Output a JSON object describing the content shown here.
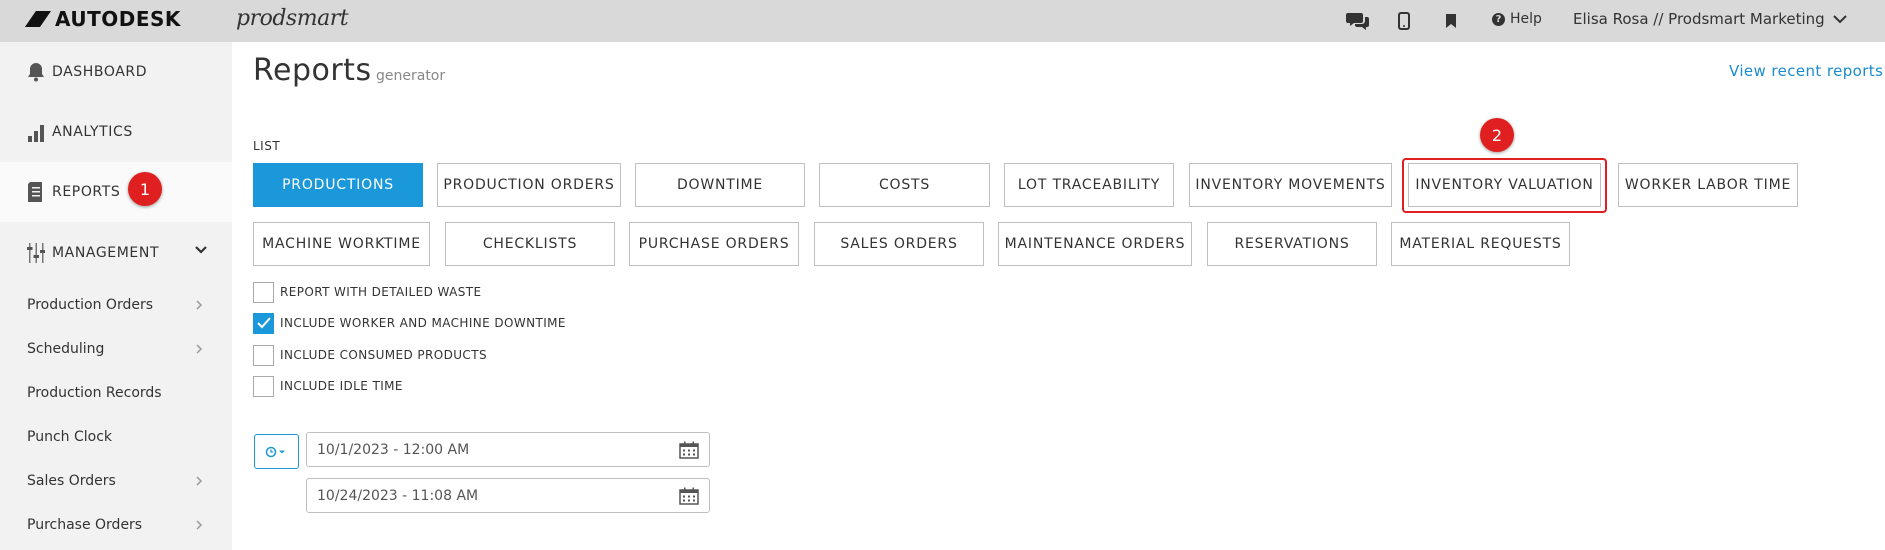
{
  "topbar": {
    "brand": "AUTODESK",
    "product": "prodsmart",
    "icons": [
      "chat-icon",
      "mobile-icon",
      "bookmark-icon"
    ],
    "help_label": "Help",
    "user_label": "Elisa Rosa // Prodsmart Marketing"
  },
  "sidebar": {
    "main_items": [
      {
        "label": "DASHBOARD",
        "icon": "bell-icon"
      },
      {
        "label": "ANALYTICS",
        "icon": "bar-chart-icon"
      },
      {
        "label": "REPORTS",
        "icon": "report-icon",
        "active": true
      },
      {
        "label": "MANAGEMENT",
        "icon": "sliders-icon",
        "expanded": true
      }
    ],
    "sub_items": [
      {
        "label": "Production Orders",
        "has_arrow": true
      },
      {
        "label": "Scheduling",
        "has_arrow": true
      },
      {
        "label": "Production Records",
        "has_arrow": false
      },
      {
        "label": "Punch Clock",
        "has_arrow": false
      },
      {
        "label": "Sales Orders",
        "has_arrow": true
      },
      {
        "label": "Purchase Orders",
        "has_arrow": true
      }
    ]
  },
  "annotations": {
    "badge1": "1",
    "badge2": "2",
    "color": "#e02020"
  },
  "main": {
    "title": "Reports",
    "subtitle": "generator",
    "recent_link": "View recent reports",
    "list_label": "LIST",
    "report_buttons_row1": [
      "PRODUCTIONS",
      "PRODUCTION ORDERS",
      "DOWNTIME",
      "COSTS",
      "LOT TRACEABILITY",
      "INVENTORY MOVEMENTS",
      "INVENTORY VALUATION",
      "WORKER LABOR TIME"
    ],
    "report_buttons_row2": [
      "MACHINE WORKTIME",
      "CHECKLISTS",
      "PURCHASE ORDERS",
      "SALES ORDERS",
      "MAINTENANCE ORDERS",
      "RESERVATIONS",
      "MATERIAL REQUESTS"
    ],
    "active_report": "PRODUCTIONS",
    "options": [
      {
        "label": "REPORT WITH DETAILED WASTE",
        "checked": false
      },
      {
        "label": "INCLUDE WORKER AND MACHINE DOWNTIME",
        "checked": true
      },
      {
        "label": "INCLUDE CONSUMED PRODUCTS",
        "checked": false
      },
      {
        "label": "INCLUDE IDLE TIME",
        "checked": false
      }
    ],
    "date_from": "10/1/2023 - 12:00 AM",
    "date_to": "10/24/2023 - 11:08 AM"
  },
  "colors": {
    "accent": "#1b98d9",
    "link": "#1a8ccf",
    "topbar_bg": "#d9d9d9",
    "sidebar_bg": "#f2f2f2"
  }
}
